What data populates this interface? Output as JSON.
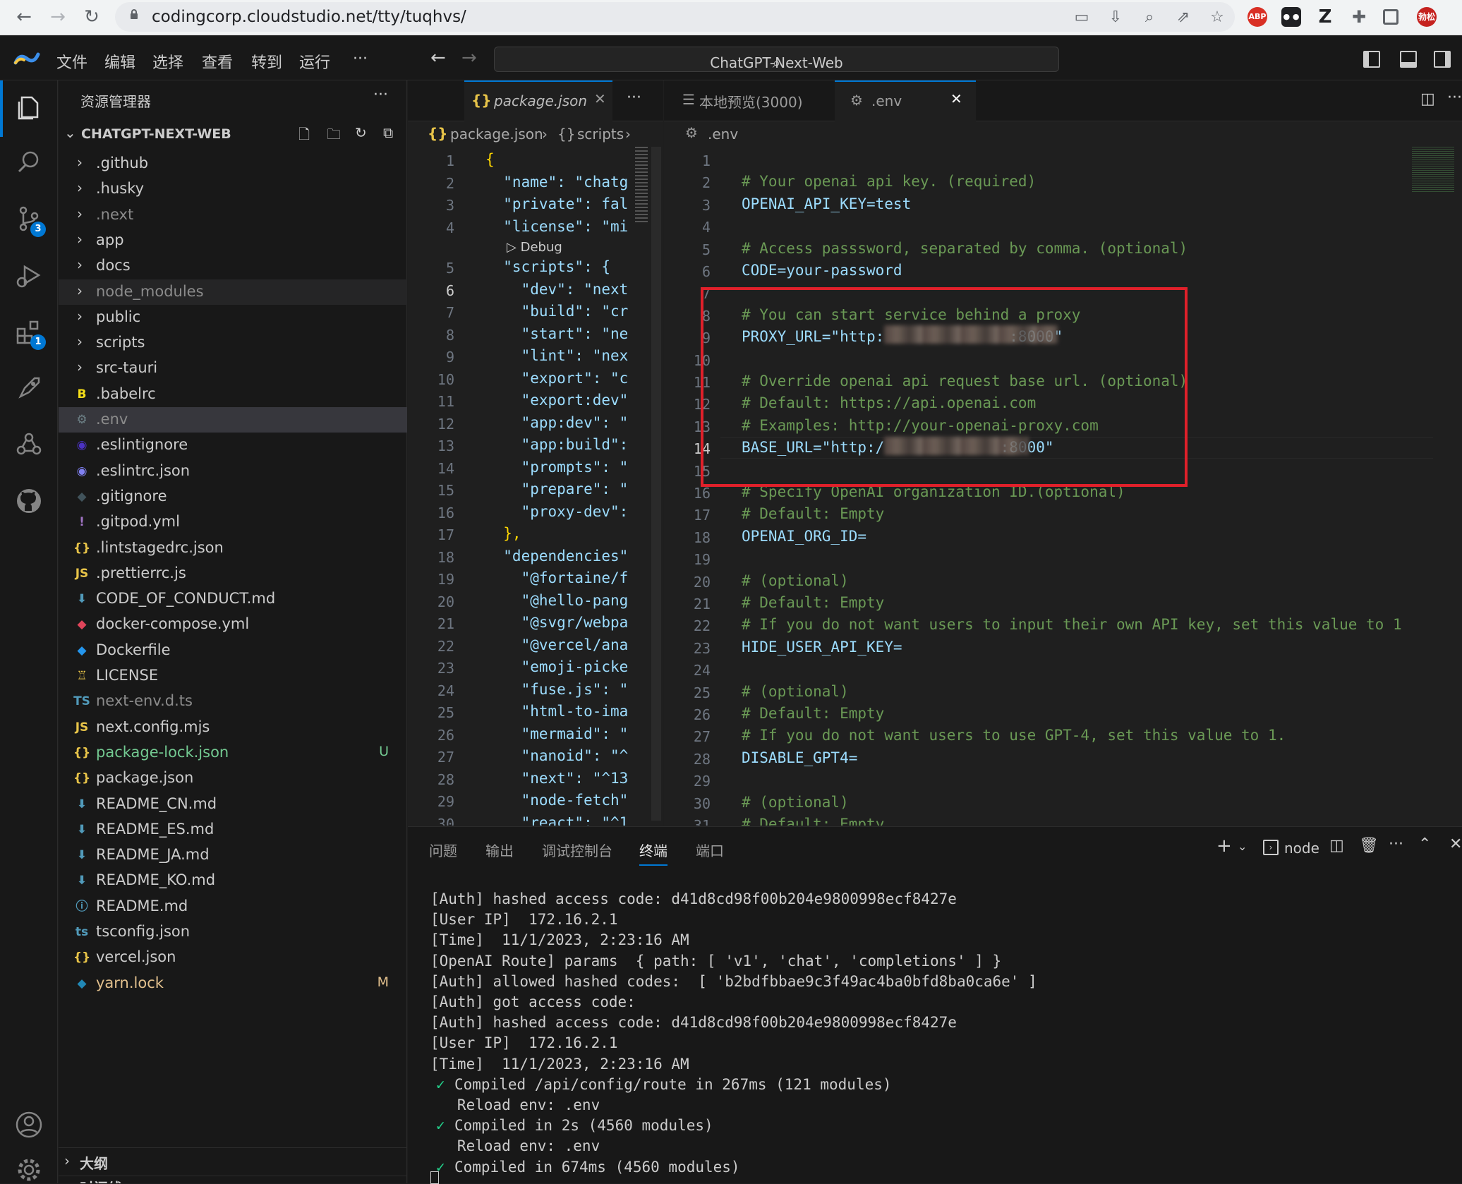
{
  "browser": {
    "url": "codingcorp.cloudstudio.net/tty/tuqhvs/",
    "ext_abp": "ABP",
    "ext_z": "Z",
    "avatar_text": "勃松"
  },
  "menubar": {
    "items": [
      "文件",
      "编辑",
      "选择",
      "查看",
      "转到",
      "运行",
      "···"
    ],
    "search": "ChatGPT-Next-Web"
  },
  "activity": {
    "scm_badge": "3",
    "ext_badge": "1"
  },
  "explorer": {
    "title": "资源管理器",
    "more": "···",
    "project": "CHATGPT-NEXT-WEB",
    "items": [
      {
        "name": ".github",
        "type": "folder"
      },
      {
        "name": ".husky",
        "type": "folder"
      },
      {
        "name": ".next",
        "type": "folder"
      },
      {
        "name": "app",
        "type": "folder"
      },
      {
        "name": "docs",
        "type": "folder"
      },
      {
        "name": "node_modules",
        "type": "folder"
      },
      {
        "name": "public",
        "type": "folder"
      },
      {
        "name": "scripts",
        "type": "folder"
      },
      {
        "name": "src-tauri",
        "type": "folder"
      },
      {
        "name": ".babelrc",
        "type": "file"
      },
      {
        "name": ".env",
        "type": "file"
      },
      {
        "name": ".eslintignore",
        "type": "file"
      },
      {
        "name": ".eslintrc.json",
        "type": "file"
      },
      {
        "name": ".gitignore",
        "type": "file"
      },
      {
        "name": ".gitpod.yml",
        "type": "file"
      },
      {
        "name": ".lintstagedrc.json",
        "type": "file"
      },
      {
        "name": ".prettierrc.js",
        "type": "file"
      },
      {
        "name": "CODE_OF_CONDUCT.md",
        "type": "file"
      },
      {
        "name": "docker-compose.yml",
        "type": "file"
      },
      {
        "name": "Dockerfile",
        "type": "file"
      },
      {
        "name": "LICENSE",
        "type": "file"
      },
      {
        "name": "next-env.d.ts",
        "type": "file"
      },
      {
        "name": "next.config.mjs",
        "type": "file"
      },
      {
        "name": "package-lock.json",
        "type": "file",
        "git": "U"
      },
      {
        "name": "package.json",
        "type": "file"
      },
      {
        "name": "README_CN.md",
        "type": "file"
      },
      {
        "name": "README_ES.md",
        "type": "file"
      },
      {
        "name": "README_JA.md",
        "type": "file"
      },
      {
        "name": "README_KO.md",
        "type": "file"
      },
      {
        "name": "README.md",
        "type": "file"
      },
      {
        "name": "tsconfig.json",
        "type": "file"
      },
      {
        "name": "vercel.json",
        "type": "file"
      },
      {
        "name": "yarn.lock",
        "type": "file",
        "git": "M"
      }
    ],
    "outline": "大纲",
    "timeline": "时间线"
  },
  "editor1": {
    "tab": "package.json",
    "crumb1": "package.json",
    "crumb2": "scripts",
    "debug": "Debug",
    "lines": [
      {
        "n": "1",
        "t": "{"
      },
      {
        "n": "2",
        "t": "  \"name\": \"chatg"
      },
      {
        "n": "3",
        "t": "  \"private\": fal"
      },
      {
        "n": "4",
        "t": "  \"license\": \"mi"
      },
      {
        "n": "5",
        "t": "  \"scripts\": {"
      },
      {
        "n": "6",
        "t": "    \"dev\": \"next"
      },
      {
        "n": "7",
        "t": "    \"build\": \"cr"
      },
      {
        "n": "8",
        "t": "    \"start\": \"ne"
      },
      {
        "n": "9",
        "t": "    \"lint\": \"nex"
      },
      {
        "n": "10",
        "t": "    \"export\": \"c"
      },
      {
        "n": "11",
        "t": "    \"export:dev\""
      },
      {
        "n": "12",
        "t": "    \"app:dev\": \""
      },
      {
        "n": "13",
        "t": "    \"app:build\":"
      },
      {
        "n": "14",
        "t": "    \"prompts\": \""
      },
      {
        "n": "15",
        "t": "    \"prepare\": \""
      },
      {
        "n": "16",
        "t": "    \"proxy-dev\":"
      },
      {
        "n": "17",
        "t": "  },"
      },
      {
        "n": "18",
        "t": "  \"dependencies\""
      },
      {
        "n": "19",
        "t": "    \"@fortaine/f"
      },
      {
        "n": "20",
        "t": "    \"@hello-pang"
      },
      {
        "n": "21",
        "t": "    \"@svgr/webpa"
      },
      {
        "n": "22",
        "t": "    \"@vercel/ana"
      },
      {
        "n": "23",
        "t": "    \"emoji-picke"
      },
      {
        "n": "24",
        "t": "    \"fuse.js\": \""
      },
      {
        "n": "25",
        "t": "    \"html-to-ima"
      },
      {
        "n": "26",
        "t": "    \"mermaid\": \""
      },
      {
        "n": "27",
        "t": "    \"nanoid\": \"^"
      },
      {
        "n": "28",
        "t": "    \"next\": \"^13"
      },
      {
        "n": "29",
        "t": "    \"node-fetch\""
      },
      {
        "n": "30",
        "t": "    \"react\": \"^1"
      }
    ]
  },
  "editor2": {
    "tab_preview": "本地预览(3000)",
    "tab_env": ".env",
    "crumb": ".env",
    "lines": [
      {
        "n": "1",
        "t": "",
        "c": "w"
      },
      {
        "n": "2",
        "t": "# Your openai api key. (required)",
        "c": "c"
      },
      {
        "n": "3",
        "t": "OPENAI_API_KEY=test",
        "c": "kv"
      },
      {
        "n": "4",
        "t": "",
        "c": "w"
      },
      {
        "n": "5",
        "t": "# Access passsword, separated by comma. (optional)",
        "c": "c"
      },
      {
        "n": "6",
        "t": "CODE=your-password",
        "c": "kv"
      },
      {
        "n": "7",
        "t": "",
        "c": "w"
      },
      {
        "n": "8",
        "t": "# You can start service behind a proxy",
        "c": "c"
      },
      {
        "n": "9",
        "t": "PROXY_URL=\"http:              :8000\"",
        "c": "kv"
      },
      {
        "n": "10",
        "t": "",
        "c": "w"
      },
      {
        "n": "11",
        "t": "# Override openai api request base url. (optional)",
        "c": "c"
      },
      {
        "n": "12",
        "t": "# Default: https://api.openai.com",
        "c": "c"
      },
      {
        "n": "13",
        "t": "# Examples: http://your-openai-proxy.com",
        "c": "c"
      },
      {
        "n": "14",
        "t": "BASE_URL=\"http:/             :8000\"",
        "c": "kv"
      },
      {
        "n": "15",
        "t": "",
        "c": "w"
      },
      {
        "n": "16",
        "t": "# Specify OpenAI organization ID.(optional)",
        "c": "c"
      },
      {
        "n": "17",
        "t": "# Default: Empty",
        "c": "c"
      },
      {
        "n": "18",
        "t": "OPENAI_ORG_ID=",
        "c": "kv"
      },
      {
        "n": "19",
        "t": "",
        "c": "w"
      },
      {
        "n": "20",
        "t": "# (optional)",
        "c": "c"
      },
      {
        "n": "21",
        "t": "# Default: Empty",
        "c": "c"
      },
      {
        "n": "22",
        "t": "# If you do not want users to input their own API key, set this value to 1",
        "c": "c"
      },
      {
        "n": "23",
        "t": "HIDE_USER_API_KEY=",
        "c": "kv"
      },
      {
        "n": "24",
        "t": "",
        "c": "w"
      },
      {
        "n": "25",
        "t": "# (optional)",
        "c": "c"
      },
      {
        "n": "26",
        "t": "# Default: Empty",
        "c": "c"
      },
      {
        "n": "27",
        "t": "# If you do not want users to use GPT-4, set this value to 1.",
        "c": "c"
      },
      {
        "n": "28",
        "t": "DISABLE_GPT4=",
        "c": "kv"
      },
      {
        "n": "29",
        "t": "",
        "c": "w"
      },
      {
        "n": "30",
        "t": "# (optional)",
        "c": "c"
      },
      {
        "n": "31",
        "t": "# Default: Empty",
        "c": "c"
      }
    ]
  },
  "panel": {
    "tabs": [
      "问题",
      "输出",
      "调试控制台",
      "终端",
      "端口"
    ],
    "active_tab": "终端",
    "terminal_name": "node",
    "terminal_lines": [
      {
        "tick": false,
        "t": "[Auth] hashed access code: d41d8cd98f00b204e9800998ecf8427e"
      },
      {
        "tick": false,
        "t": "[User IP]  172.16.2.1"
      },
      {
        "tick": false,
        "t": "[Time]  11/1/2023, 2:23:16 AM"
      },
      {
        "tick": false,
        "t": "[OpenAI Route] params  { path: [ 'v1', 'chat', 'completions' ] }"
      },
      {
        "tick": false,
        "t": "[Auth] allowed hashed codes:  [ 'b2bdfbbae9c3f49ac4ba0bfd8ba0ca6e' ]"
      },
      {
        "tick": false,
        "t": "[Auth] got access code:"
      },
      {
        "tick": false,
        "t": "[Auth] hashed access code: d41d8cd98f00b204e9800998ecf8427e"
      },
      {
        "tick": false,
        "t": "[User IP]  172.16.2.1"
      },
      {
        "tick": false,
        "t": "[Time]  11/1/2023, 2:23:16 AM"
      },
      {
        "tick": true,
        "t": "Compiled /api/config/route in 267ms (121 modules)"
      },
      {
        "tick": false,
        "t": "   Reload env: .env"
      },
      {
        "tick": true,
        "t": "Compiled in 2s (4560 modules)"
      },
      {
        "tick": false,
        "t": "   Reload env: .env"
      },
      {
        "tick": true,
        "t": "Compiled in 674ms (4560 modules)"
      }
    ]
  },
  "colors": {
    "accent": "#0078d4",
    "highlight_box": "#e0202a",
    "untracked": "#73c991",
    "modified": "#e2c08d"
  }
}
